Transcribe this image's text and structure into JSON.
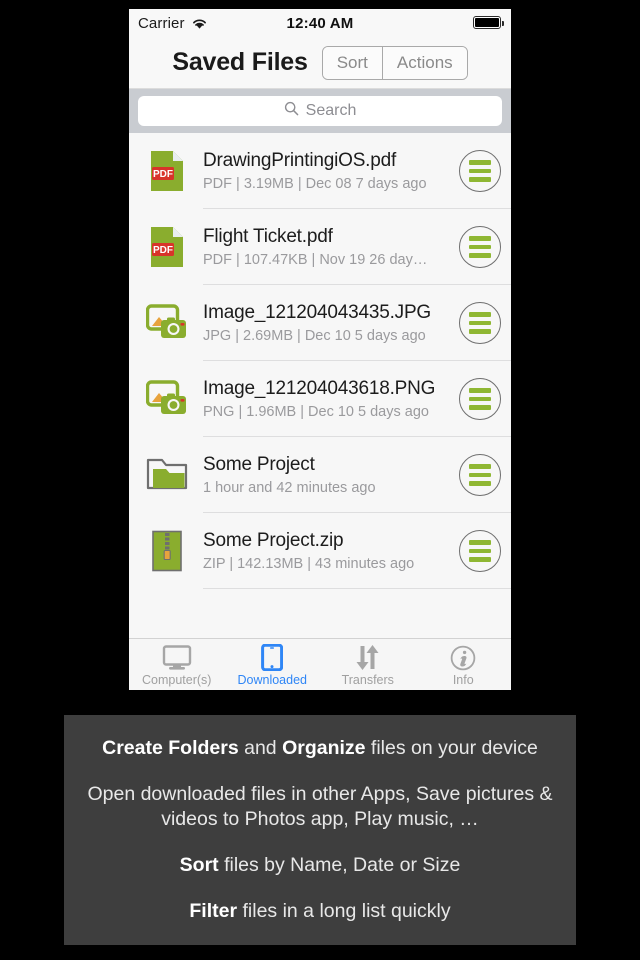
{
  "status_bar": {
    "carrier": "Carrier",
    "time": "12:40 AM",
    "wifi_icon": "wifi-icon",
    "battery_icon": "battery-full-icon"
  },
  "nav_bar": {
    "title": "Saved Files",
    "segments": [
      {
        "label": "Sort",
        "name": "sort-segment"
      },
      {
        "label": "Actions",
        "name": "actions-segment"
      }
    ]
  },
  "search": {
    "placeholder": "Search",
    "value": "",
    "icon": "search-icon"
  },
  "files": [
    {
      "name": "DrawingPrintingiOS.pdf",
      "meta": "PDF | 3.19MB | Dec 08    7 days ago",
      "icon": "pdf-file-icon",
      "type": "pdf"
    },
    {
      "name": "Flight Ticket.pdf",
      "meta": "PDF | 107.47KB | Nov 19    26 day…",
      "icon": "pdf-file-icon",
      "type": "pdf"
    },
    {
      "name": "Image_121204043435.JPG",
      "meta": "JPG | 2.69MB | Dec 10    5 days ago",
      "icon": "image-file-icon",
      "type": "image"
    },
    {
      "name": "Image_121204043618.PNG",
      "meta": "PNG | 1.96MB | Dec 10    5 days ago",
      "icon": "image-file-icon",
      "type": "image"
    },
    {
      "name": "Some Project",
      "meta": "1 hour and 42 minutes ago",
      "icon": "folder-icon",
      "type": "folder"
    },
    {
      "name": "Some Project.zip",
      "meta": "ZIP | 142.13MB |  43 minutes ago",
      "icon": "zip-file-icon",
      "type": "zip"
    }
  ],
  "row_accessory": {
    "name": "row-menu-button",
    "icon": "hamburger-circle-icon"
  },
  "tabs": [
    {
      "label": "Computer(s)",
      "icon": "desktop-icon",
      "name": "tab-computers",
      "active": false
    },
    {
      "label": "Downloaded",
      "icon": "tablet-icon",
      "name": "tab-downloaded",
      "active": true
    },
    {
      "label": "Transfers",
      "icon": "up-down-arrows-icon",
      "name": "tab-transfers",
      "active": false
    },
    {
      "label": "Info",
      "icon": "info-circle-icon",
      "name": "tab-info",
      "active": false
    }
  ],
  "caption": {
    "line1": {
      "bold1": "Create Folders",
      "mid": " and ",
      "bold2": "Organize",
      "rest": " files on your device"
    },
    "line2": "Open downloaded files in other Apps, Save pictures & videos to Photos app, Play music, …",
    "line3": {
      "bold": "Sort",
      "rest": " files by Name, Date or Size"
    },
    "line4": {
      "bold": "Filter",
      "rest": " files in a long list quickly"
    }
  },
  "colors": {
    "accent_green": "#8fb733",
    "pdf_red": "#d8342a",
    "active_blue": "#2f86f6",
    "panel_bg": "#3e3e3e",
    "search_bg": "#c9ccd1"
  }
}
